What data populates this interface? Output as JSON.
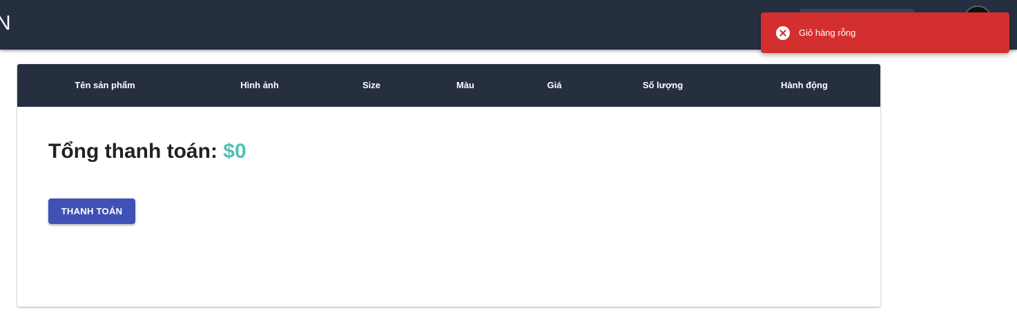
{
  "header": {
    "brand": "N"
  },
  "cart_table": {
    "columns": [
      {
        "label": "Tên sản phẩm"
      },
      {
        "label": "Hình ảnh"
      },
      {
        "label": "Size"
      },
      {
        "label": "Màu"
      },
      {
        "label": "Giá"
      },
      {
        "label": "Số lượng"
      },
      {
        "label": "Hành động"
      }
    ]
  },
  "summary": {
    "total_label": "Tổng thanh toán:",
    "total_value": "$0",
    "checkout_button": "THANH TOÁN"
  },
  "toast": {
    "type": "error",
    "icon": "close-circle-icon",
    "message": "Giỏ hàng rỗng"
  },
  "colors": {
    "header_bg": "#252f40",
    "accent_total": "#52c0b7",
    "button_bg": "#3f51b5",
    "toast_bg": "#d32f2f"
  }
}
